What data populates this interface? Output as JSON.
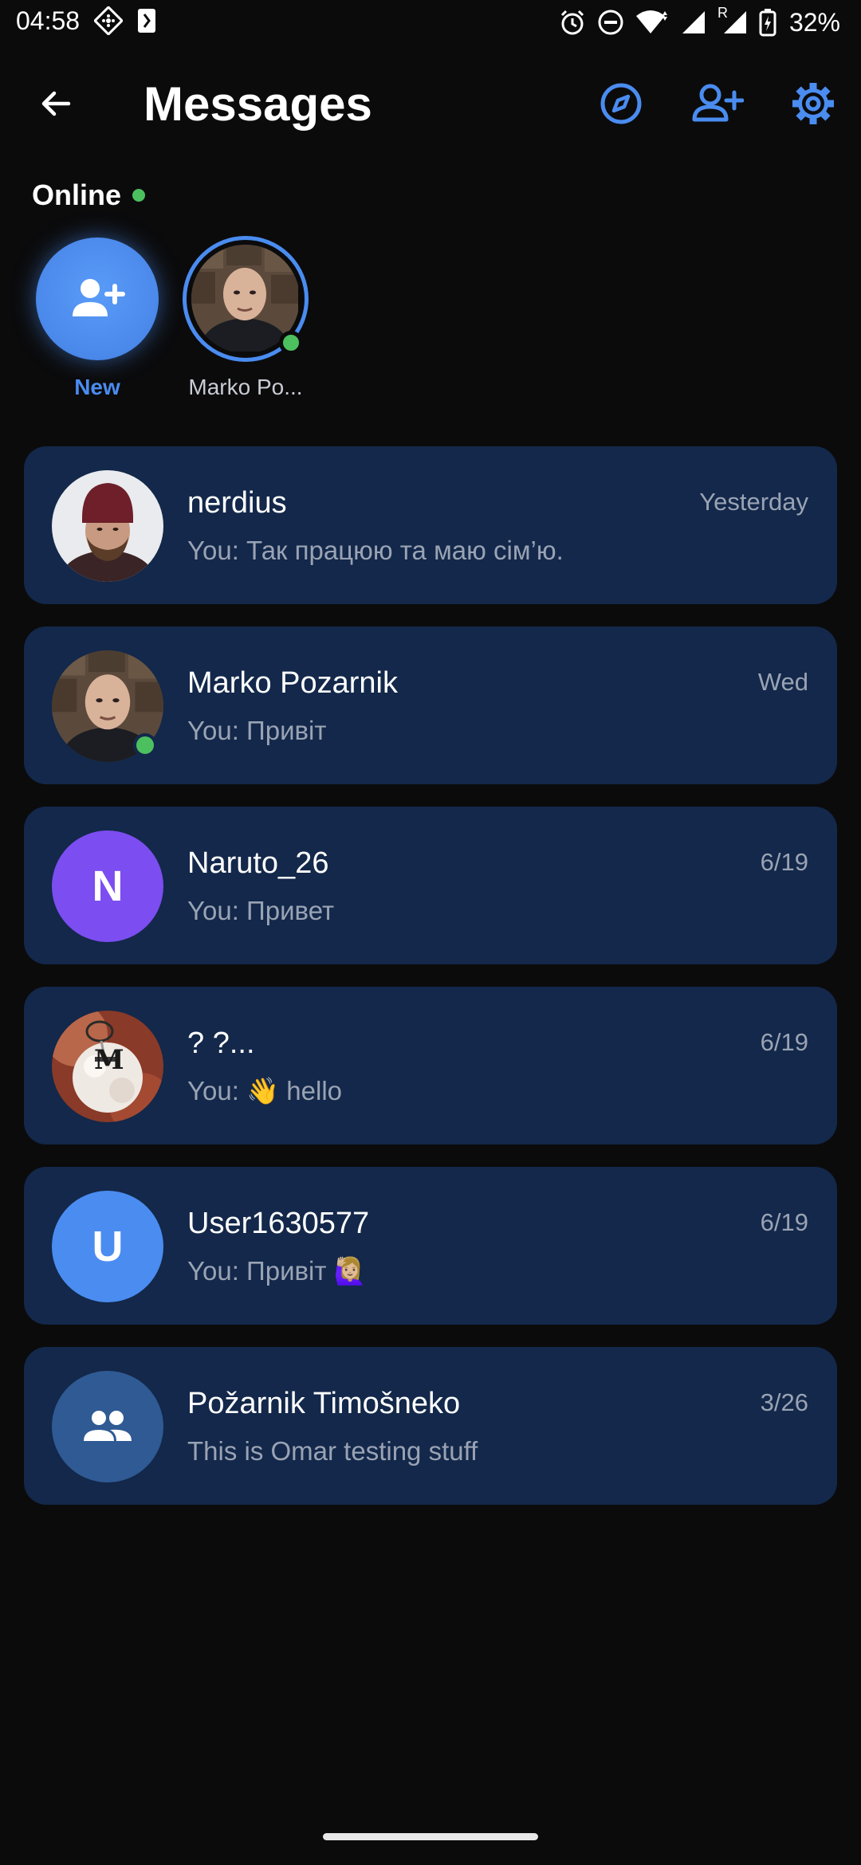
{
  "status_bar": {
    "time": "04:58",
    "battery_percent": "32%",
    "network_roaming": "R"
  },
  "header": {
    "title": "Messages",
    "accent_color": "#4a8cf0"
  },
  "online": {
    "label": "Online",
    "new_label": "New",
    "users": [
      {
        "name": "Marko Po..."
      }
    ]
  },
  "conversations": [
    {
      "name": "nerdius",
      "message": "You: Так працюю та маю сім’ю.",
      "time": "Yesterday",
      "avatar_type": "photo",
      "online": false
    },
    {
      "name": "Marko Pozarnik",
      "message": "You: Привіт",
      "time": "Wed",
      "avatar_type": "photo",
      "online": true
    },
    {
      "name": "Naruto_26",
      "message": "You: Привет",
      "time": "6/19",
      "avatar_type": "letter",
      "avatar_letter": "N",
      "avatar_color": "#7c4df0",
      "online": false
    },
    {
      "name": "? ?...",
      "message": "You: 👋 hello",
      "time": "6/19",
      "avatar_type": "photo",
      "avatar_letter": "M",
      "online": false
    },
    {
      "name": "User1630577",
      "message": "You: Привіт 🙋🏼‍♀️",
      "time": "6/19",
      "avatar_type": "letter",
      "avatar_letter": "U",
      "avatar_color": "#4a8cf0",
      "online": false
    },
    {
      "name": "Požarnik Timošneko",
      "message": "This is Omar testing stuff",
      "time": "3/26",
      "avatar_type": "group",
      "avatar_color": "#2f5a94",
      "online": false
    }
  ],
  "colors": {
    "background": "#0b0b0c",
    "card": "#13284a",
    "online_green": "#4cc05f",
    "secondary_text": "#9aa3b4"
  }
}
